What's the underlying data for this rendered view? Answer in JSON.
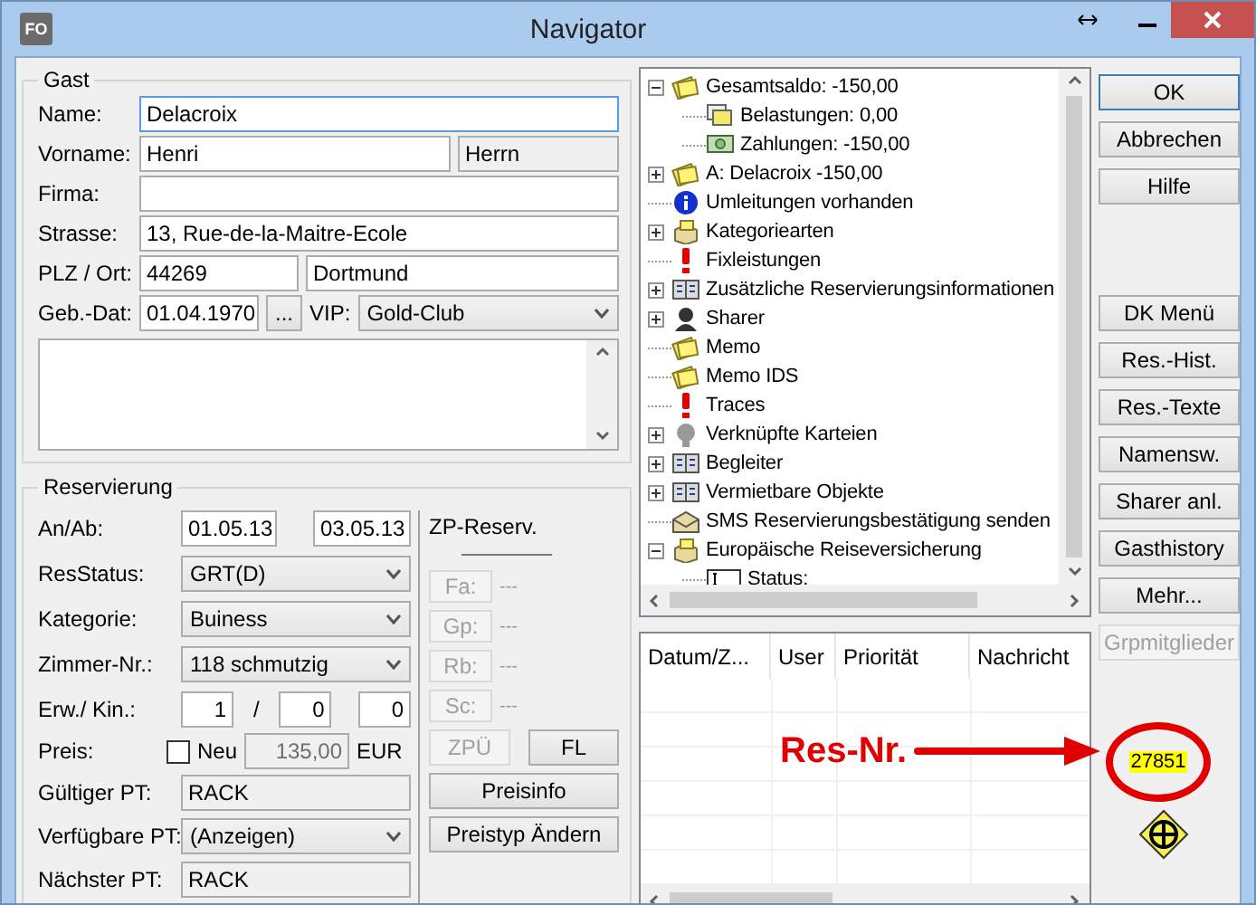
{
  "window": {
    "title": "Navigator",
    "app_icon": "FO"
  },
  "guest": {
    "title": "Gast",
    "name": {
      "label": "Name:",
      "value": "Delacroix",
      "focused": true
    },
    "first_name": {
      "label": "Vorname:",
      "value": "Henri",
      "salutation": "Herrn"
    },
    "company": {
      "label": "Firma:"
    },
    "street": {
      "label": "Strasse:",
      "value": "13, Rue-de-la-Maitre-Ecole"
    },
    "city": {
      "label": "PLZ / Ort:",
      "zip": "44269",
      "city": "Dortmund"
    },
    "birth_date": {
      "label": "Geb.-Dat:",
      "value": "01.04.1970",
      "picker": "...",
      "vip_label": "VIP:",
      "vip": "Gold-Club"
    }
  },
  "reservation": {
    "title": "Reservierung",
    "dates": {
      "label": "An/Ab:",
      "arrival": "01.05.13",
      "departure": "03.05.13"
    },
    "selects": [
      {
        "label": "ResStatus:",
        "value": "GRT(D)"
      },
      {
        "label": "Kategorie:",
        "value": "Buiness"
      },
      {
        "label": "Zimmer-Nr.:",
        "value": "118 schmutzig"
      }
    ],
    "persons": {
      "label": "Erw./ Kin.:",
      "adults": "1",
      "separator": "/",
      "children_1": "0",
      "children_2": "0"
    },
    "price": {
      "label": "Preis:",
      "new_label": "Neu",
      "new_checked": false,
      "amount": "135,00",
      "currency": "EUR"
    },
    "rate_rows": [
      {
        "kind": "text",
        "label": "Gültiger PT:",
        "value": "RACK"
      },
      {
        "kind": "select",
        "label": "Verfügbare PT:",
        "value": "(Anzeigen)"
      },
      {
        "kind": "text",
        "label": "Nächster PT:",
        "value": "RACK"
      }
    ],
    "zp": {
      "title": "ZP-Reserv.",
      "items": [
        {
          "label": "Fa:",
          "value": "---",
          "disabled": true
        },
        {
          "label": "Gp:",
          "value": "---",
          "disabled": true
        },
        {
          "label": "Rb:",
          "value": "---",
          "disabled": true
        },
        {
          "label": "Sc:",
          "value": "---",
          "disabled": true
        }
      ],
      "buttons": [
        {
          "label": "ZPÜ",
          "disabled": true
        },
        {
          "label": "FL",
          "disabled": false
        }
      ],
      "wide_buttons": [
        "Preisinfo",
        "Preistyp Ändern"
      ]
    }
  },
  "tree": [
    {
      "label": "Gesamtsaldo: -150,00",
      "kind": "notes",
      "expanded": true,
      "children": [
        {
          "label": "Belastungen: 0,00",
          "kind": "stack"
        },
        {
          "label": "Zahlungen: -150,00",
          "kind": "money"
        }
      ]
    },
    {
      "label": "A: Delacroix -150,00",
      "kind": "notes",
      "expanded": false
    },
    {
      "label": "Umleitungen vorhanden",
      "kind": "info"
    },
    {
      "label": "Kategoriearten",
      "kind": "box",
      "expanded": false
    },
    {
      "label": "Fixleistungen",
      "kind": "alert"
    },
    {
      "label": "Zusätzliche Reservierungsinformationen",
      "kind": "book",
      "expanded": false
    },
    {
      "label": "Sharer",
      "kind": "person",
      "expanded": false
    },
    {
      "label": "Memo",
      "kind": "notes"
    },
    {
      "label": "Memo IDS",
      "kind": "notes"
    },
    {
      "label": "Traces",
      "kind": "alert"
    },
    {
      "label": "Verknüpfte Karteien",
      "kind": "head",
      "expanded": false
    },
    {
      "label": "Begleiter",
      "kind": "book",
      "expanded": false
    },
    {
      "label": "Vermietbare Objekte",
      "kind": "book",
      "expanded": false
    },
    {
      "label": "SMS Reservierungsbestätigung senden",
      "kind": "sms"
    },
    {
      "label": "Europäische Reiseversicherung",
      "kind": "box",
      "expanded": true,
      "children": [
        {
          "label": "Status:",
          "kind": "field"
        }
      ]
    }
  ],
  "messages": {
    "columns": [
      "Datum/Z...",
      "User",
      "Priorität",
      "Nachricht"
    ]
  },
  "buttons_top": [
    {
      "label": "OK",
      "default": true,
      "disabled": false
    },
    {
      "label": "Abbrechen",
      "default": false,
      "disabled": false
    },
    {
      "label": "Hilfe",
      "default": false,
      "disabled": false
    }
  ],
  "buttons_bottom": [
    {
      "label": "DK Menü",
      "default": false,
      "disabled": false
    },
    {
      "label": "Res.-Hist.",
      "default": false,
      "disabled": false
    },
    {
      "label": "Res.-Texte",
      "default": false,
      "disabled": false
    },
    {
      "label": "Namensw.",
      "default": false,
      "disabled": false
    },
    {
      "label": "Sharer anl.",
      "default": false,
      "disabled": false
    },
    {
      "label": "Gasthistory",
      "default": false,
      "disabled": false
    },
    {
      "label": "Mehr...",
      "default": false,
      "disabled": false
    },
    {
      "label": "Grpmitglieder",
      "default": false,
      "disabled": true
    }
  ],
  "annotation": {
    "label": "Res-Nr.",
    "reservation_number": "27851"
  }
}
